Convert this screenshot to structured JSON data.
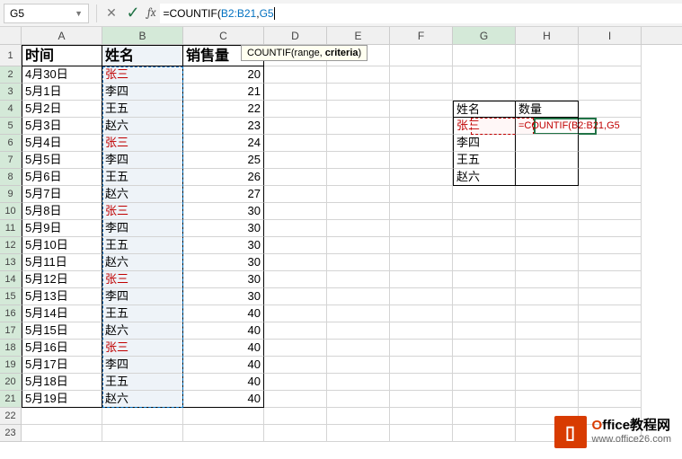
{
  "nameBox": "G5",
  "formulaBar": {
    "prefix": "=COUNTIF(",
    "range": "B2:B21",
    "comma": ",",
    "arg": "G5"
  },
  "tooltip": {
    "func": "COUNTIF(",
    "p1": "range, ",
    "p2": "criteria",
    "p3": ")"
  },
  "cols": [
    "A",
    "B",
    "C",
    "D",
    "E",
    "F",
    "G",
    "H",
    "I"
  ],
  "headers": {
    "A": "时间",
    "B": "姓名",
    "C": "销售量"
  },
  "rows": [
    {
      "n": 2,
      "A": "4月30日",
      "B": "张三",
      "Br": true,
      "C": "20"
    },
    {
      "n": 3,
      "A": "5月1日",
      "B": "李四",
      "C": "21"
    },
    {
      "n": 4,
      "A": "5月2日",
      "B": "王五",
      "C": "22"
    },
    {
      "n": 5,
      "A": "5月3日",
      "B": "赵六",
      "C": "23"
    },
    {
      "n": 6,
      "A": "5月4日",
      "B": "张三",
      "Br": true,
      "C": "24"
    },
    {
      "n": 7,
      "A": "5月5日",
      "B": "李四",
      "C": "25"
    },
    {
      "n": 8,
      "A": "5月6日",
      "B": "王五",
      "C": "26"
    },
    {
      "n": 9,
      "A": "5月7日",
      "B": "赵六",
      "C": "27"
    },
    {
      "n": 10,
      "A": "5月8日",
      "B": "张三",
      "Br": true,
      "C": "30"
    },
    {
      "n": 11,
      "A": "5月9日",
      "B": "李四",
      "C": "30"
    },
    {
      "n": 12,
      "A": "5月10日",
      "B": "王五",
      "C": "30"
    },
    {
      "n": 13,
      "A": "5月11日",
      "B": "赵六",
      "C": "30"
    },
    {
      "n": 14,
      "A": "5月12日",
      "B": "张三",
      "Br": true,
      "C": "30"
    },
    {
      "n": 15,
      "A": "5月13日",
      "B": "李四",
      "C": "30"
    },
    {
      "n": 16,
      "A": "5月14日",
      "B": "王五",
      "C": "40"
    },
    {
      "n": 17,
      "A": "5月15日",
      "B": "赵六",
      "C": "40"
    },
    {
      "n": 18,
      "A": "5月16日",
      "B": "张三",
      "Br": true,
      "C": "40"
    },
    {
      "n": 19,
      "A": "5月17日",
      "B": "李四",
      "C": "40"
    },
    {
      "n": 20,
      "A": "5月18日",
      "B": "王五",
      "C": "40"
    },
    {
      "n": 21,
      "A": "5月19日",
      "B": "赵六",
      "C": "40"
    }
  ],
  "side": {
    "header": {
      "G": "姓名",
      "H": "数量"
    },
    "rows": [
      {
        "G": "张三",
        "H": "=COUNTIF(B2:B21,G5"
      },
      {
        "G": "李四",
        "H": ""
      },
      {
        "G": "王五",
        "H": ""
      },
      {
        "G": "赵六",
        "H": ""
      }
    ]
  },
  "watermark": {
    "title1": "O",
    "title2": "ffice教程网",
    "url": "www.office26.com"
  }
}
